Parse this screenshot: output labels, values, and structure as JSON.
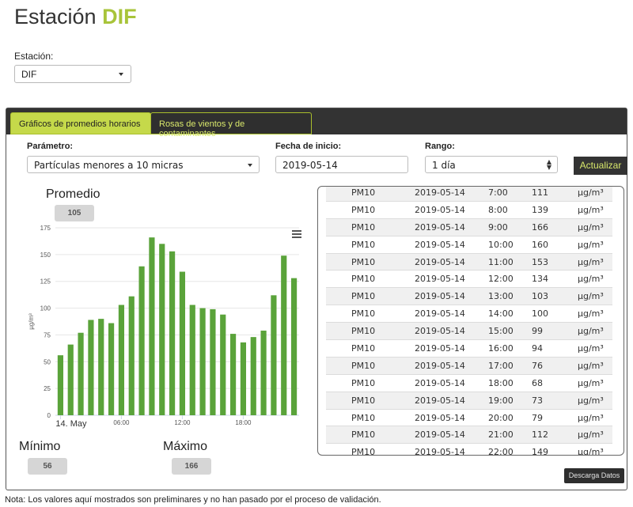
{
  "page": {
    "title_prefix": "Estación",
    "title_station": "DIF",
    "note": "Nota: Los valores aquí mostrados son preliminares y no han pasado por el proceso de validación."
  },
  "station": {
    "label": "Estación:",
    "selected": "DIF"
  },
  "tabs": [
    {
      "label": "Gráficos de promedios horarios",
      "active": true
    },
    {
      "label": "Rosas de vientos y de contaminantes",
      "active": false
    }
  ],
  "controls": {
    "parameter_label": "Parámetro:",
    "parameter_value": "Partículas menores a 10 micras",
    "start_label": "Fecha de inicio:",
    "start_value": "2019-05-14",
    "range_label": "Rango:",
    "range_value": "1 día",
    "update_button": "Actualizar"
  },
  "stats": {
    "average_label": "Promedio",
    "average_value": "105",
    "min_label": "Mínimo",
    "min_value": "56",
    "max_label": "Máximo",
    "max_value": "166"
  },
  "chart_data": {
    "type": "bar",
    "x": [
      0,
      1,
      2,
      3,
      4,
      5,
      6,
      7,
      8,
      9,
      10,
      11,
      12,
      13,
      14,
      15,
      16,
      17,
      18,
      19,
      20,
      21,
      22,
      23
    ],
    "values": [
      56,
      66,
      77,
      89,
      90,
      86,
      103,
      111,
      139,
      166,
      160,
      153,
      134,
      103,
      100,
      99,
      94,
      76,
      68,
      73,
      79,
      112,
      149,
      128
    ],
    "ylabel": "µg/m³",
    "ylim": [
      0,
      175
    ],
    "yticks": [
      "0",
      "25",
      "50",
      "75",
      "100",
      "125",
      "150",
      "175"
    ],
    "xtick_labels": [
      "14. May",
      "06:00",
      "12:00",
      "18:00"
    ],
    "xtick_hours": [
      0,
      6,
      12,
      18
    ],
    "bar_color": "#5aa33a",
    "grid": true
  },
  "table": {
    "rows": [
      [
        "PM10",
        "2019-05-14",
        "7:00",
        "111",
        "µg/m³"
      ],
      [
        "PM10",
        "2019-05-14",
        "8:00",
        "139",
        "µg/m³"
      ],
      [
        "PM10",
        "2019-05-14",
        "9:00",
        "166",
        "µg/m³"
      ],
      [
        "PM10",
        "2019-05-14",
        "10:00",
        "160",
        "µg/m³"
      ],
      [
        "PM10",
        "2019-05-14",
        "11:00",
        "153",
        "µg/m³"
      ],
      [
        "PM10",
        "2019-05-14",
        "12:00",
        "134",
        "µg/m³"
      ],
      [
        "PM10",
        "2019-05-14",
        "13:00",
        "103",
        "µg/m³"
      ],
      [
        "PM10",
        "2019-05-14",
        "14:00",
        "100",
        "µg/m³"
      ],
      [
        "PM10",
        "2019-05-14",
        "15:00",
        "99",
        "µg/m³"
      ],
      [
        "PM10",
        "2019-05-14",
        "16:00",
        "94",
        "µg/m³"
      ],
      [
        "PM10",
        "2019-05-14",
        "17:00",
        "76",
        "µg/m³"
      ],
      [
        "PM10",
        "2019-05-14",
        "18:00",
        "68",
        "µg/m³"
      ],
      [
        "PM10",
        "2019-05-14",
        "19:00",
        "73",
        "µg/m³"
      ],
      [
        "PM10",
        "2019-05-14",
        "20:00",
        "79",
        "µg/m³"
      ],
      [
        "PM10",
        "2019-05-14",
        "21:00",
        "112",
        "µg/m³"
      ],
      [
        "PM10",
        "2019-05-14",
        "22:00",
        "149",
        "µg/m³"
      ]
    ]
  },
  "download_button": "Descarga Datos",
  "colors": {
    "accent": "#a8c43a",
    "tab_active": "#c5d94a",
    "dark": "#333333",
    "bar": "#5aa33a"
  }
}
